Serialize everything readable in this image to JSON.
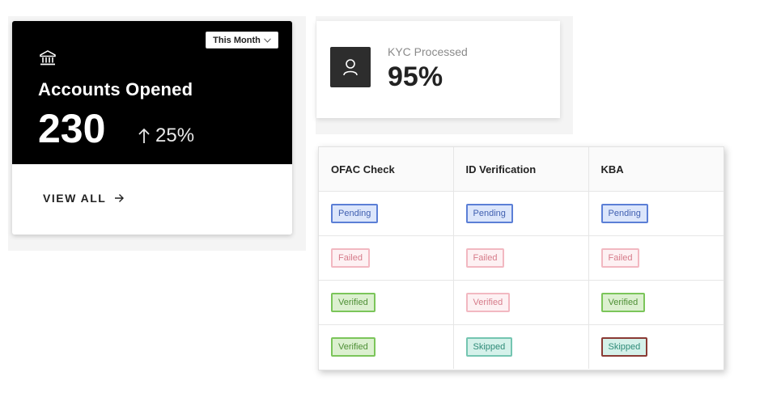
{
  "accounts_card": {
    "period_selector": "This Month",
    "title": "Accounts Opened",
    "value": "230",
    "trend": "25%",
    "view_all": "VIEW ALL",
    "icon": "bank-icon"
  },
  "kyc_card": {
    "label": "KYC Processed",
    "value": "95%",
    "icon": "user-icon"
  },
  "status_table": {
    "headers": [
      "OFAC Check",
      "ID Verification",
      "KBA"
    ],
    "rows": [
      [
        "Pending",
        "Pending",
        "Pending"
      ],
      [
        "Failed",
        "Failed",
        "Failed"
      ],
      [
        "Verified",
        "Verified",
        "Verified"
      ],
      [
        "Verified",
        "Skipped",
        "Skipped"
      ]
    ]
  },
  "colors": {
    "card_dark": "#000000",
    "pending": "#5b7fd6",
    "failed": "#f2b8c1",
    "verified": "#7bc55a",
    "skipped": "#74c5b1"
  }
}
